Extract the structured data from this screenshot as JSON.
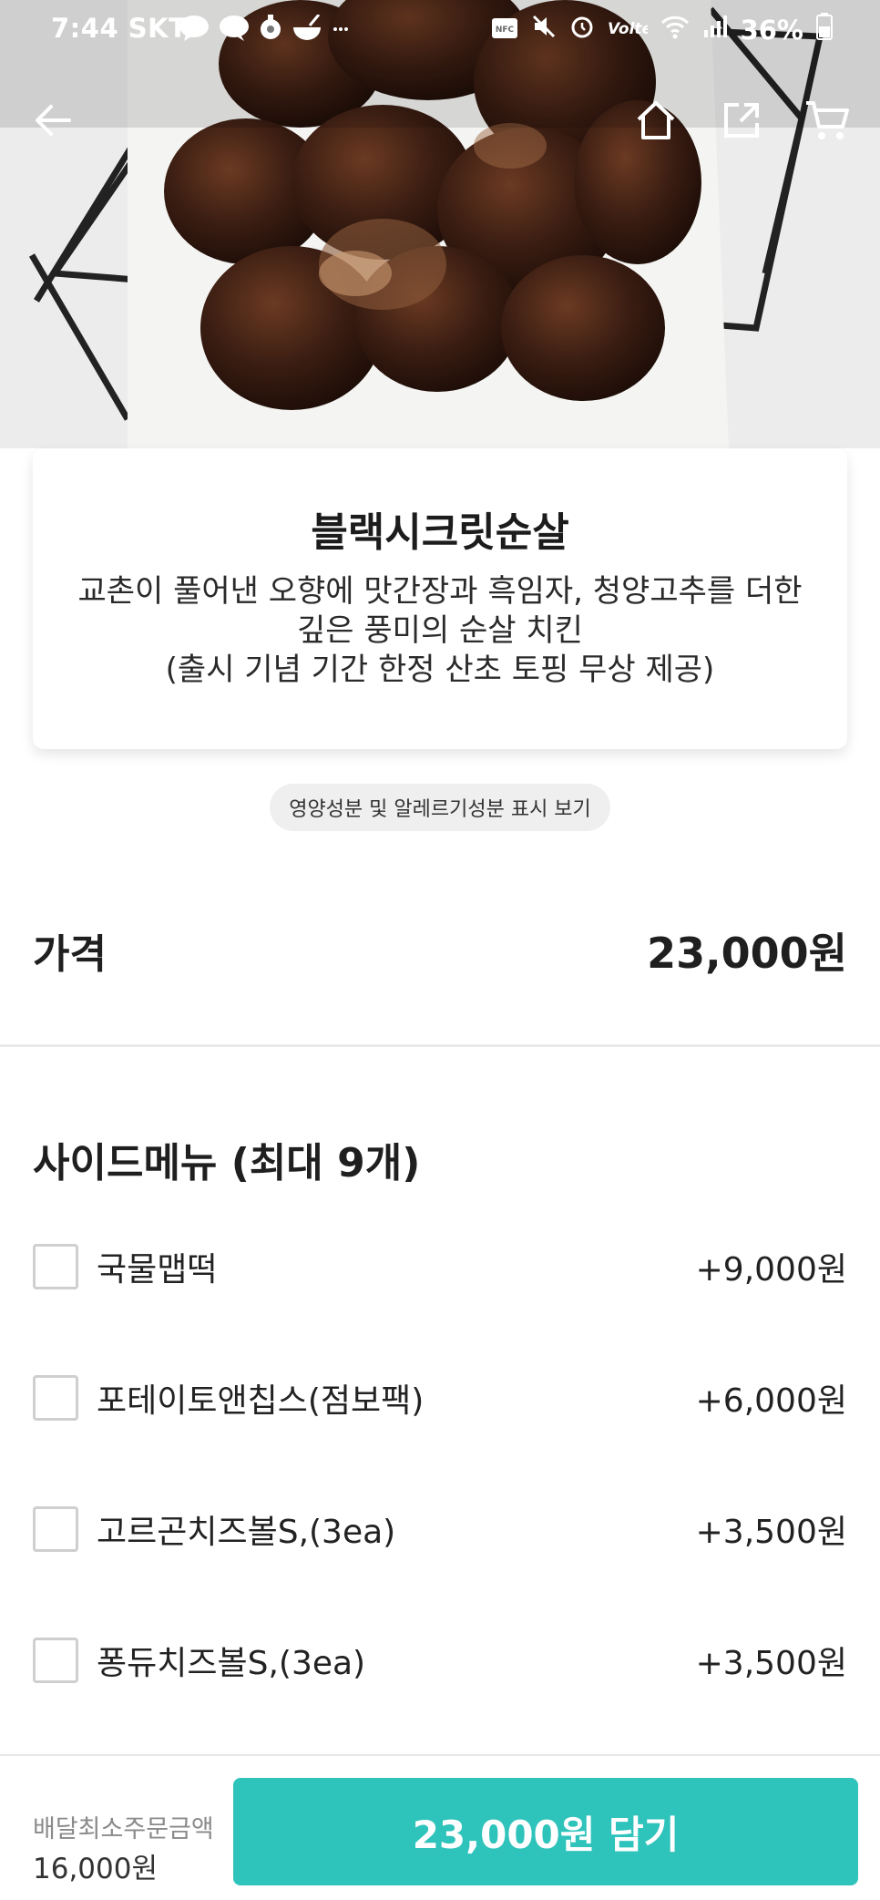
{
  "status_bar": {
    "time": "7:44 SKT",
    "battery": "36%",
    "icons": [
      "talk-icon",
      "chat-icon",
      "location-icon",
      "food-icon",
      "more-icon",
      "nfc-icon",
      "mute-icon",
      "alarm-icon",
      "volte-icon",
      "wifi-icon",
      "signal-icon",
      "battery-icon"
    ]
  },
  "nav": {
    "icons": [
      "back-arrow-icon",
      "home-icon",
      "share-icon",
      "cart-icon"
    ]
  },
  "product": {
    "title": "블랙시크릿순살",
    "desc_line1": "교촌이 풀어낸 오향에 맛간장과 흑임자, 청양고추를 더한",
    "desc_line2": "깊은 풍미의 순살 치킨",
    "desc_line3": "(출시 기념 기간 한정 산초 토핑 무상 제공)",
    "nutrition_link": "영양성분 및 알레르기성분 표시 보기"
  },
  "price": {
    "label": "가격",
    "value": "23,000원"
  },
  "side_menu": {
    "title": "사이드메뉴 (최대 9개)",
    "items": [
      {
        "name": "국물맵떡",
        "price": "+9,000원",
        "checked": false
      },
      {
        "name": "포테이토앤칩스(점보팩)",
        "price": "+6,000원",
        "checked": false
      },
      {
        "name": "고르곤치즈볼S,(3ea)",
        "price": "+3,500원",
        "checked": false
      },
      {
        "name": "퐁듀치즈볼S,(3ea)",
        "price": "+3,500원",
        "checked": false
      }
    ]
  },
  "bottom_bar": {
    "min_order_label": "배달최소주문금액",
    "min_order_value": "16,000원",
    "add_button": "23,000원 담기"
  },
  "colors": {
    "accent": "#2ec3bb"
  }
}
